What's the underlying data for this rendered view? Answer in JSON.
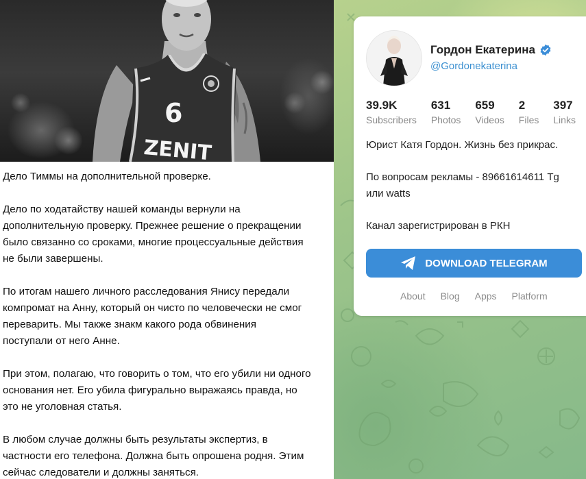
{
  "post": {
    "photo_jersey_number": "6",
    "photo_jersey_text": "ZENIT",
    "paragraphs": [
      "Дело Тиммы на дополнительной проверке.",
      "Дело по ходатайству нашей команды вернули на\nдополнительную проверку. Прежнее решение о прекращении\nбыло связанно со сроками, многие процессуальные действия\nне были завершены.",
      "По итогам нашего личного расследования Янису передали\nкомпромат на Анну, который он чисто по человечески не смог\nпереварить. Мы также знакм какого рода обвинения\nпоступали от него Анне.",
      "При этом, полагаю, что говорить о том, что его убили ни одного\nоснования нет. Его убила фигурально выражаясь правда, но\nэто не уголовная статья.",
      "В любом случае должны быть результаты экспертиз, в\nчастности его телефона. Должна быть опрошена родня. Этим\nсейчас следователи и должны заняться."
    ]
  },
  "channel": {
    "name": "Гордон Екатерина",
    "handle": "@Gordonekaterina",
    "stats": [
      {
        "num": "39.9K",
        "label": "Subscribers"
      },
      {
        "num": "631",
        "label": "Photos"
      },
      {
        "num": "659",
        "label": "Videos"
      },
      {
        "num": "2",
        "label": "Files"
      },
      {
        "num": "397",
        "label": "Links"
      }
    ],
    "description": [
      "Юрист Катя Гордон. Жизнь без прикрас.",
      "По вопросам рекламы - 89661614611 Tg или watts",
      "Канал зарегистрирован в РКН"
    ],
    "download_label": "DOWNLOAD TELEGRAM",
    "footer_links": [
      "About",
      "Blog",
      "Apps",
      "Platform"
    ]
  },
  "colors": {
    "accent": "#3b8dd8",
    "handle": "#3a8fd0",
    "verified": "#3b8dd8",
    "bg_green": "#9ec58a"
  },
  "icons": {
    "verified": "verified-check-icon",
    "download": "telegram-plane-icon"
  }
}
